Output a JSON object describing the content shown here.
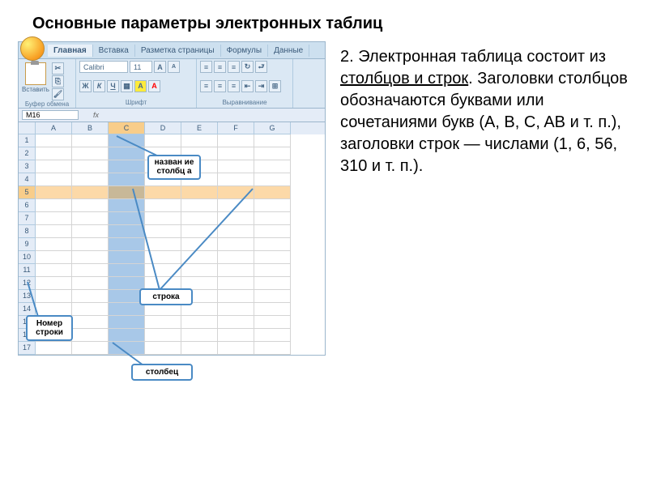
{
  "title": "Основные параметры электронных таблиц",
  "ribbon": {
    "tabs": [
      "Главная",
      "Вставка",
      "Разметка страницы",
      "Формулы",
      "Данные"
    ],
    "paste_label": "Вставить",
    "group_clipboard": "Буфер обмена",
    "group_font": "Шрифт",
    "group_align": "Выравнивание",
    "font_name": "Calibri",
    "font_size": "11"
  },
  "namebox": "M16",
  "columns": [
    "A",
    "B",
    "C",
    "D",
    "E",
    "F",
    "G"
  ],
  "rows": [
    "1",
    "2",
    "3",
    "4",
    "5",
    "6",
    "7",
    "8",
    "9",
    "10",
    "11",
    "12",
    "13",
    "14",
    "15",
    "16",
    "17"
  ],
  "selected_col_index": 2,
  "selected_row_index": 4,
  "callouts": {
    "col_name": "назван\nие\nстолбц\nа",
    "row": "строка",
    "row_num": "Номер\nстроки",
    "column": "столбец"
  },
  "explanation": {
    "prefix": "2. Электронная таблица состоит из ",
    "underlined": "столбцов и строк",
    "rest": ". Заголовки столбцов обозначаются буквами или сочетаниями букв (A, B, C,  AB и т. п.), заголовки строк — числами (1, 6, 56, 310 и т. п.)."
  }
}
